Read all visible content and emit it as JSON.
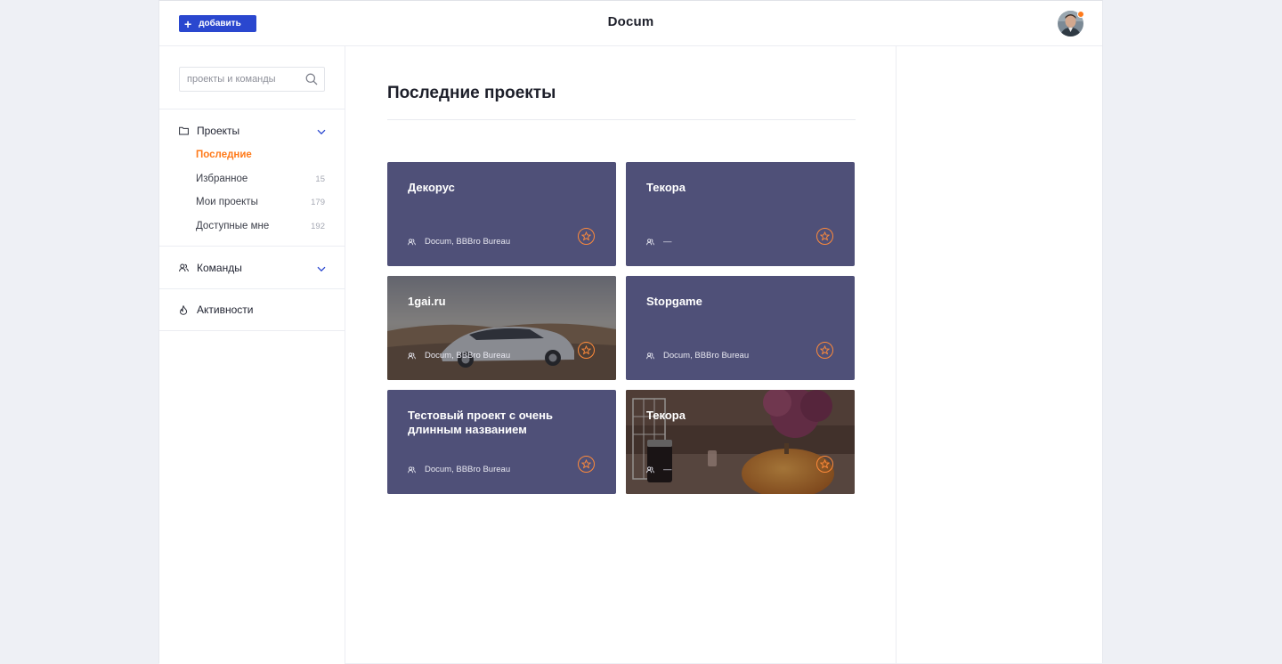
{
  "header": {
    "add_label": "добавить",
    "brand": "Docum"
  },
  "sidebar": {
    "search_placeholder": "проекты и команды",
    "projects": {
      "label": "Проекты",
      "items": [
        {
          "label": "Последние",
          "count": ""
        },
        {
          "label": "Избранное",
          "count": "15"
        },
        {
          "label": "Мои проекты",
          "count": "179"
        },
        {
          "label": "Доступные мне",
          "count": "192"
        }
      ]
    },
    "teams_label": "Команды",
    "activity_label": "Активности"
  },
  "main": {
    "title": "Последние проекты",
    "cards": [
      {
        "title": "Декорус",
        "meta": "Docum, BBBro Bureau",
        "background": "solid"
      },
      {
        "title": "Текора",
        "meta": "—",
        "background": "solid"
      },
      {
        "title": "1gai.ru",
        "meta": "Docum, BBBro Bureau",
        "background": "photo-car"
      },
      {
        "title": "Stopgame",
        "meta": "Docum, BBBro Bureau",
        "background": "solid"
      },
      {
        "title": "Тестовый проект с очень длинным названием",
        "meta": "Docum, BBBro Bureau",
        "background": "solid"
      },
      {
        "title": "Текора",
        "meta": "—",
        "background": "photo-autumn"
      }
    ]
  },
  "colors": {
    "accent_blue": "#2a47cf",
    "accent_orange": "#ff7a1a",
    "card_bg": "#4f5078"
  },
  "icons": [
    "plus-icon",
    "search-icon",
    "folder-icon",
    "chevron-down-icon",
    "team-icon",
    "flame-icon",
    "star-icon"
  ]
}
